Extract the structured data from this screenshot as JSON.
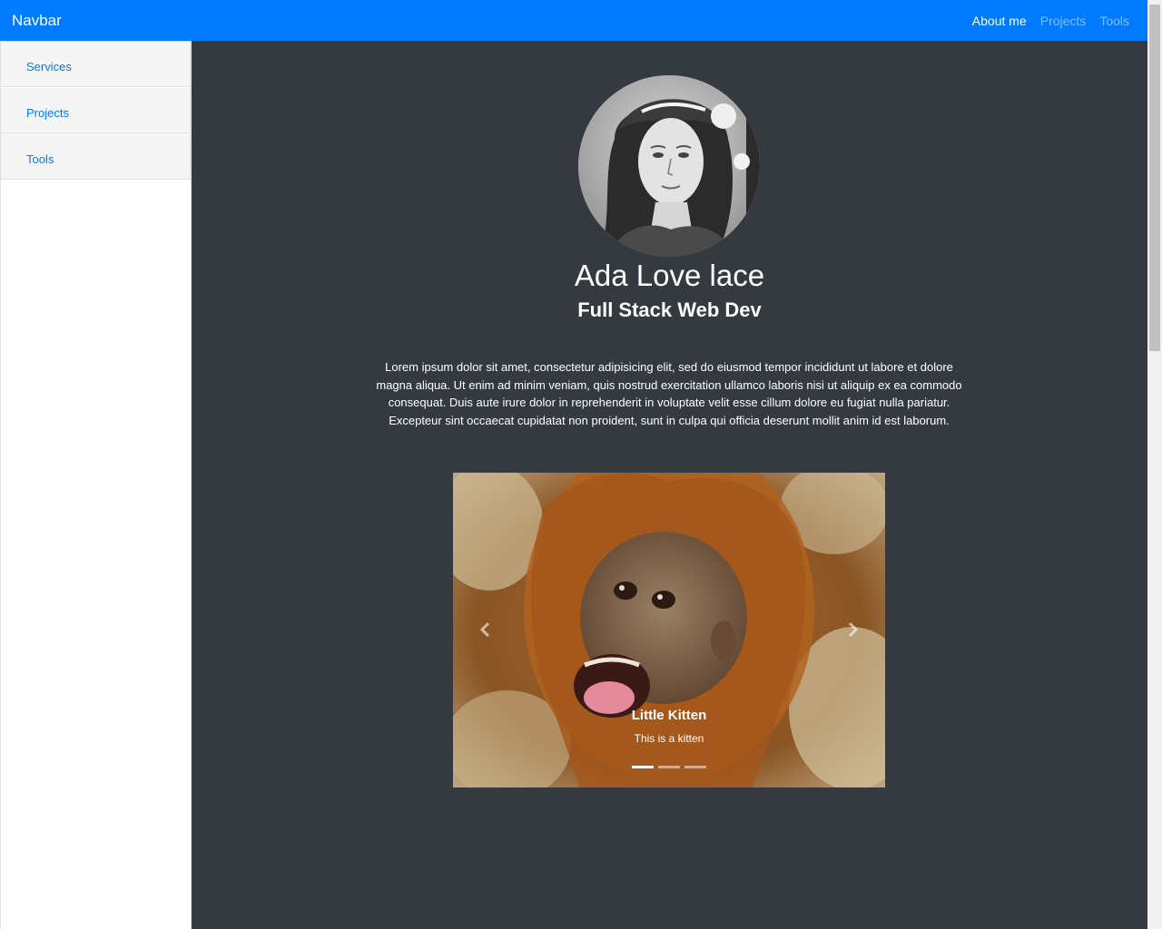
{
  "navbar": {
    "brand": "Navbar",
    "links": [
      {
        "label": "About me",
        "active": true
      },
      {
        "label": "Projects",
        "active": false
      },
      {
        "label": "Tools",
        "active": false
      }
    ]
  },
  "sidebar": {
    "items": [
      {
        "label": "Services"
      },
      {
        "label": "Projects"
      },
      {
        "label": "Tools"
      }
    ]
  },
  "profile": {
    "name": "Ada Love lace",
    "role": "Full Stack Web Dev",
    "bio": "Lorem ipsum dolor sit amet, consectetur adipisicing elit, sed do eiusmod tempor incididunt ut labore et dolore magna aliqua. Ut enim ad minim veniam, quis nostrud exercitation ullamco laboris nisi ut aliquip ex ea commodo consequat. Duis aute irure dolor in reprehenderit in voluptate velit esse cillum dolore eu fugiat nulla pariatur. Excepteur sint occaecat cupidatat non proident, sunt in culpa qui officia deserunt mollit anim id est laborum."
  },
  "carousel": {
    "caption_title": "Little Kitten",
    "caption_text": "This is a kitten",
    "slide_count": 3,
    "active_index": 0
  },
  "colors": {
    "primary": "#007bff",
    "main_bg": "#343a40",
    "sidebar_bg": "#f5f5f5"
  }
}
